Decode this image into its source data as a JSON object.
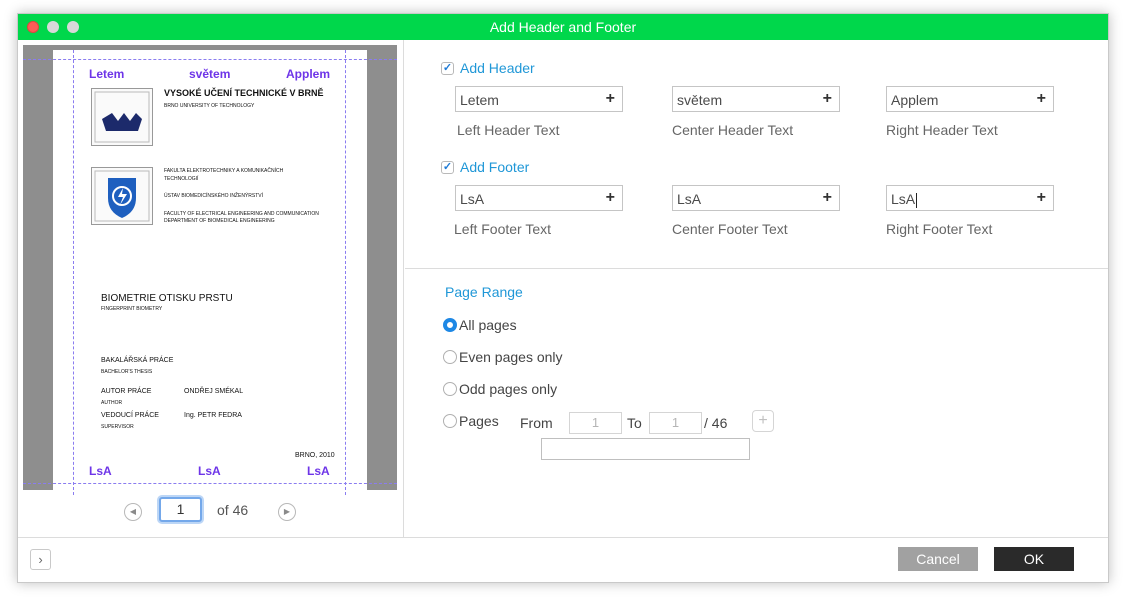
{
  "window": {
    "title": "Add Header and Footer"
  },
  "preview": {
    "header": {
      "left": "Letem",
      "center": "světem",
      "right": "Applem"
    },
    "footer": {
      "left": "LsA",
      "center": "LsA",
      "right": "LsA"
    },
    "document": {
      "university": "VYSOKÉ UČENÍ TECHNICKÉ V BRNĚ",
      "university_en": "BRNO UNIVERSITY OF TECHNOLOGY",
      "faculty": "FAKULTA ELEKTROTECHNIKY A KOMUNIKAČNÍCH",
      "faculty_2": "TECHNOLOGIÍ",
      "institute": "ÚSTAV BIOMEDICÍNSKÉHO INŽENÝRSTVÍ",
      "faculty_en": "FACULTY OF ELECTRICAL ENGINEERING AND COMMUNICATION",
      "institute_en": "DEPARTMENT OF BIOMEDICAL ENGINEERING",
      "thesis_title": "BIOMETRIE OTISKU PRSTU",
      "thesis_title_en": "FINGERPRINT BIOMETRY",
      "thesis_type": "BAKALÁŘSKÁ PRÁCE",
      "thesis_type_en": "BACHELOR'S THESIS",
      "author_label": "AUTOR PRÁCE",
      "author_label_en": "AUTHOR",
      "author_name": "ONDŘEJ SMÉKAL",
      "supervisor_label": "VEDOUCÍ PRÁCE",
      "supervisor_label_en": "SUPERVISOR",
      "supervisor_name": "Ing. PETR FEDRA",
      "place_year": "BRNO, 2010"
    },
    "pager": {
      "current": "1",
      "of_label": "of 46"
    }
  },
  "header_section": {
    "checkbox_label": "Add Header",
    "checked": true,
    "left": {
      "value": "Letem",
      "caption": "Left Header Text"
    },
    "center": {
      "value": "světem",
      "caption": "Center Header Text"
    },
    "right": {
      "value": "Applem",
      "caption": "Right Header Text"
    }
  },
  "footer_section": {
    "checkbox_label": "Add Footer",
    "checked": true,
    "left": {
      "value": "LsA",
      "caption": "Left Footer Text"
    },
    "center": {
      "value": "LsA",
      "caption": "Center Footer Text"
    },
    "right": {
      "value": "LsA",
      "caption": "Right Footer Text"
    }
  },
  "page_range": {
    "title": "Page Range",
    "options": [
      "All pages",
      "Even pages only",
      "Odd pages only",
      "Pages"
    ],
    "selected": "All pages",
    "from_label": "From",
    "from_value": "1",
    "to_label": "To",
    "to_value": "1",
    "total": "/ 46"
  },
  "buttons": {
    "cancel": "Cancel",
    "ok": "OK"
  },
  "colors": {
    "titlebar": "#00d74b",
    "accent": "#1f97d7",
    "hf_text": "#6e35e8"
  }
}
